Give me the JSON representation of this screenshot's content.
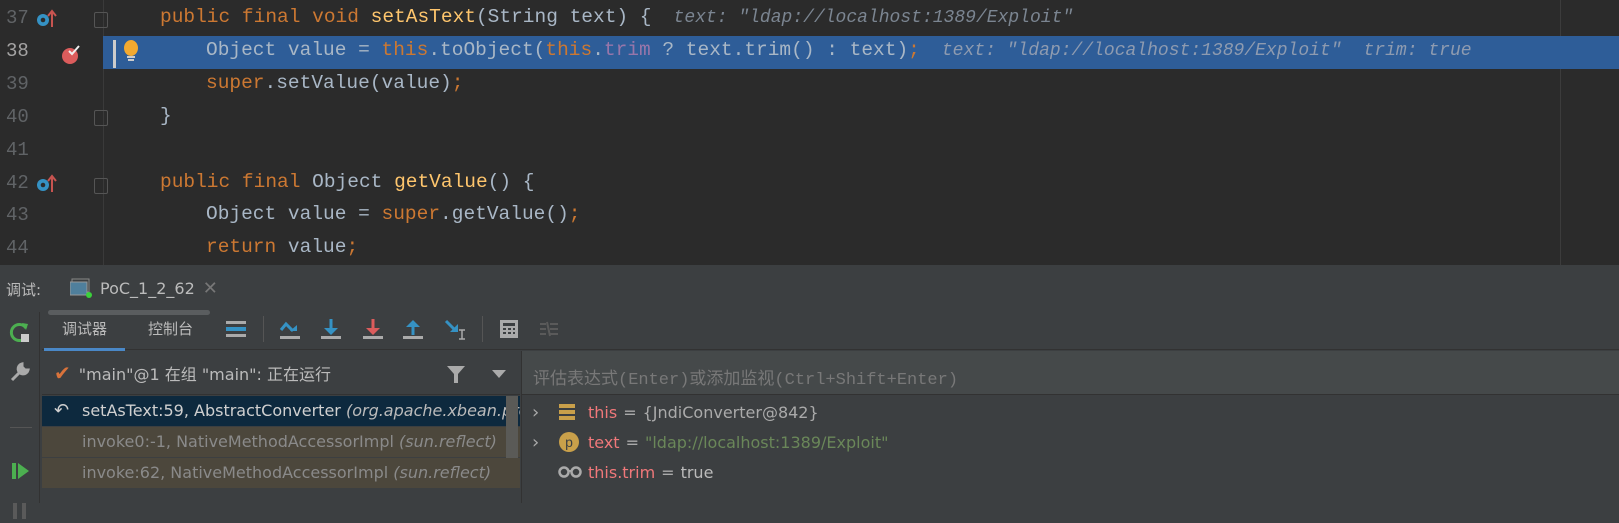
{
  "editor": {
    "lines": [
      {
        "num": "37",
        "indent": 1,
        "tokens": [
          {
            "t": "public ",
            "c": "k"
          },
          {
            "t": "final ",
            "c": "k"
          },
          {
            "t": "void ",
            "c": "k"
          },
          {
            "t": "setAsText",
            "c": "m"
          },
          {
            "t": "(String text) {",
            "c": "d"
          }
        ],
        "hints": [
          "text: \"ldap://localhost:1389/Exploit\""
        ]
      },
      {
        "num": "38",
        "indent": 2,
        "selected": true,
        "tokens": [
          {
            "t": "Object value = ",
            "c": "d"
          },
          {
            "t": "this",
            "c": "k"
          },
          {
            "t": ".toObject(",
            "c": "d"
          },
          {
            "t": "this",
            "c": "k"
          },
          {
            "t": ".",
            "c": "d"
          },
          {
            "t": "trim",
            "c": "f"
          },
          {
            "t": " ? text.trim() : text)",
            "c": "d"
          },
          {
            "t": ";",
            "c": "k"
          }
        ],
        "hints": [
          "text: \"ldap://localhost:1389/Exploit\"",
          "trim: true"
        ]
      },
      {
        "num": "39",
        "indent": 2,
        "tokens": [
          {
            "t": "super",
            "c": "k"
          },
          {
            "t": ".setValue(value)",
            "c": "d"
          },
          {
            "t": ";",
            "c": "k"
          }
        ],
        "hints": []
      },
      {
        "num": "40",
        "indent": 1,
        "tokens": [
          {
            "t": "}",
            "c": "d"
          }
        ],
        "hints": []
      },
      {
        "num": "41",
        "indent": 1,
        "tokens": [],
        "hints": []
      },
      {
        "num": "42",
        "indent": 1,
        "tokens": [
          {
            "t": "public ",
            "c": "k"
          },
          {
            "t": "final ",
            "c": "k"
          },
          {
            "t": "Object ",
            "c": "d"
          },
          {
            "t": "getValue",
            "c": "m"
          },
          {
            "t": "() {",
            "c": "d"
          }
        ],
        "hints": []
      },
      {
        "num": "43",
        "indent": 2,
        "tokens": [
          {
            "t": "Object value = ",
            "c": "d"
          },
          {
            "t": "super",
            "c": "k"
          },
          {
            "t": ".getValue()",
            "c": "d"
          },
          {
            "t": ";",
            "c": "k"
          }
        ],
        "hints": []
      },
      {
        "num": "44",
        "indent": 2,
        "tokens": [
          {
            "t": "return ",
            "c": "k"
          },
          {
            "t": "value",
            "c": "d"
          },
          {
            "t": ";",
            "c": "k"
          }
        ],
        "hints": []
      }
    ]
  },
  "debug": {
    "label": "调试:",
    "session_tab": "PoC_1_2_62",
    "tabs": [
      "调试器",
      "控制台"
    ],
    "thread": "\"main\"@1 在组 \"main\": 正在运行",
    "frames": [
      {
        "method": "setAsText:59, AbstractConverter ",
        "pkg": "(org.apache.xbean.propertyeditor)",
        "selected": true
      },
      {
        "method": "invoke0:-1, NativeMethodAccessorImpl ",
        "pkg": "(sun.reflect)"
      },
      {
        "method": "invoke:62, NativeMethodAccessorImpl ",
        "pkg": "(sun.reflect)"
      }
    ],
    "eval_placeholder": "评估表达式(Enter)或添加监视(Ctrl+Shift+Enter)",
    "variables": [
      {
        "name": "this",
        "eq": "=",
        "value": "{JndiConverter@842}",
        "icon": "field-list-icon",
        "expandable": true
      },
      {
        "name": "text",
        "eq": "=",
        "value": "\"ldap://localhost:1389/Exploit\"",
        "icon": "parameter-icon",
        "expandable": true,
        "string": true
      },
      {
        "name": "this.trim",
        "eq": "=",
        "value": "true",
        "icon": "watch-glasses-icon",
        "expandable": false
      }
    ]
  },
  "colors": {
    "selection": "#2e5d98",
    "keyword": "#cc7832",
    "method": "#ffc66d",
    "field": "#9876aa"
  }
}
